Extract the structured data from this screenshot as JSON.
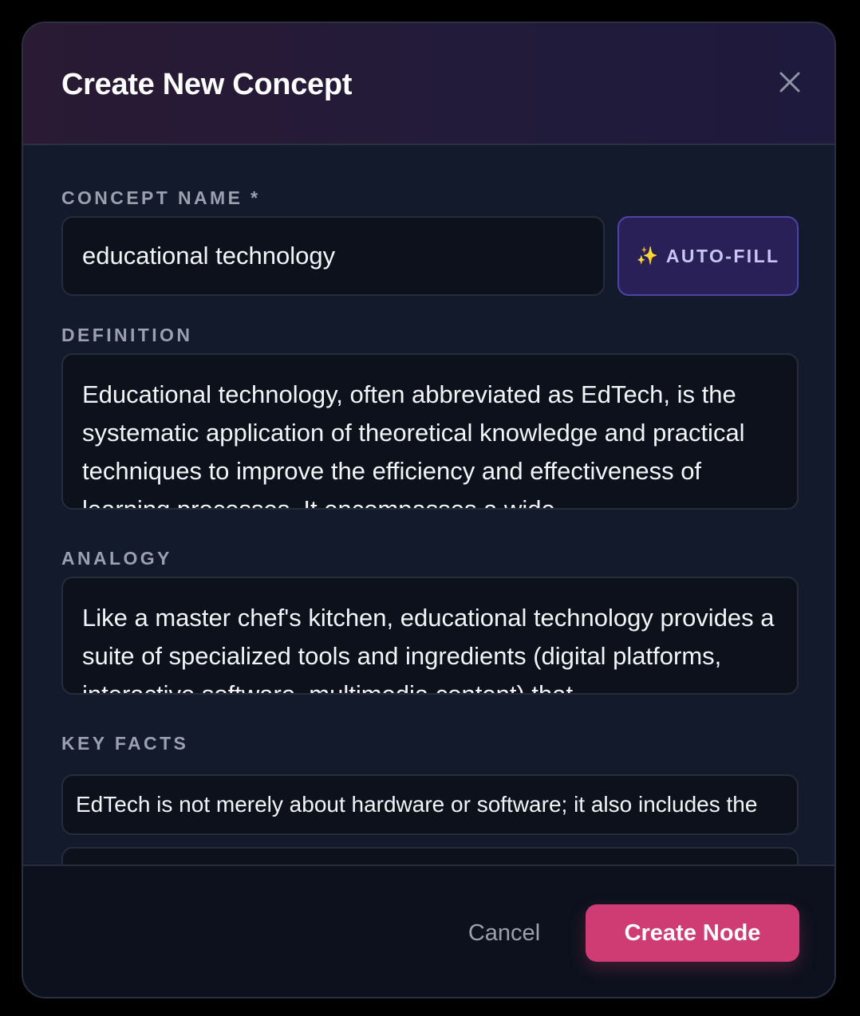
{
  "dialog": {
    "title": "Create New Concept",
    "close_icon": "close-icon"
  },
  "concept_name": {
    "label": "CONCEPT NAME *",
    "value": "educational technology"
  },
  "auto_fill": {
    "icon": "sparkles-icon",
    "icon_glyph": "✨",
    "label": "AUTO-FILL"
  },
  "definition": {
    "label": "DEFINITION",
    "value": "Educational technology, often abbreviated as EdTech, is the systematic application of theoretical knowledge and practical techniques to improve the efficiency and effectiveness of learning processes. It encompasses a wide"
  },
  "analogy": {
    "label": "ANALOGY",
    "value": "Like a master chef's kitchen, educational technology provides a suite of specialized tools and ingredients (digital platforms, interactive software, multimedia content) that"
  },
  "key_facts": {
    "label": "KEY FACTS",
    "items": [
      "EdTech is not merely about hardware or software; it also includes the",
      ""
    ]
  },
  "footer": {
    "cancel_label": "Cancel",
    "create_label": "Create Node"
  },
  "colors": {
    "accent": "#cf3b73",
    "autofill_bg": "#2a2058",
    "autofill_border": "#4d44a6",
    "panel_bg": "#121a2c",
    "input_bg": "#0c111b"
  }
}
